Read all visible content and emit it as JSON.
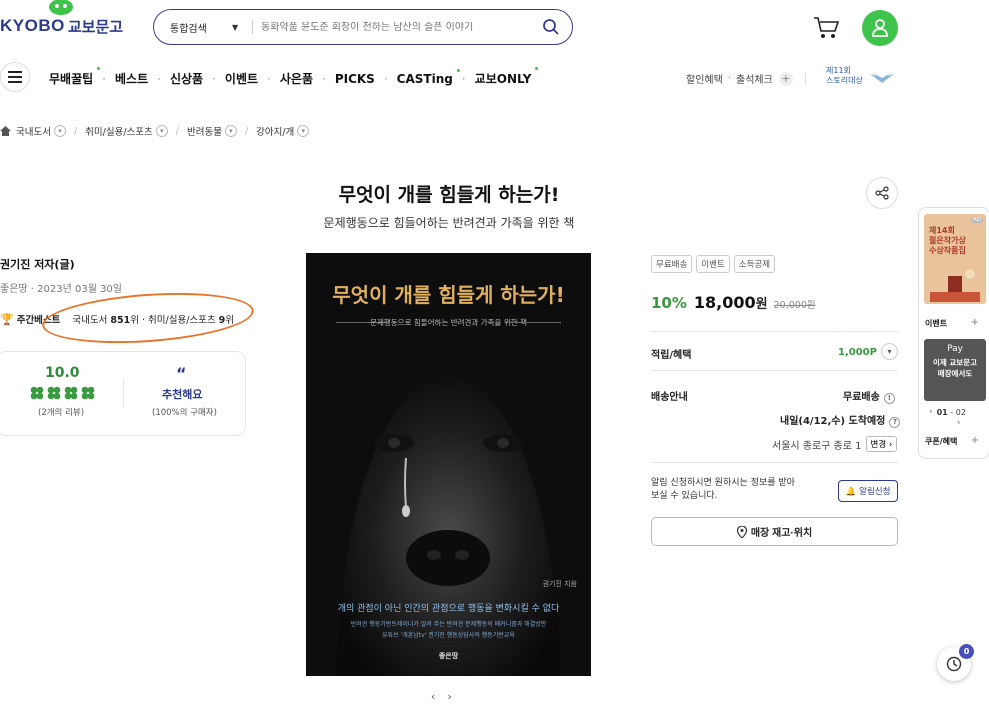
{
  "header": {
    "logo_text": "KYOBO",
    "logo_kr": "교보문고",
    "search_scope": "통합검색",
    "search_placeholder": "동화약품 윤도준 회장이 전하는 남산의 슬픈 이야기",
    "brand_color": "#2b3a8a",
    "accent_color": "#3ec44a"
  },
  "nav": {
    "items": [
      "무배꿀팁",
      "베스트",
      "신상품",
      "이벤트",
      "사은품",
      "PICKS",
      "CASTing",
      "교보ONLY"
    ],
    "discount": "할인혜택",
    "attendance": "출석체크",
    "award": [
      "제11회",
      "스토리대상"
    ]
  },
  "breadcrumb": [
    "국내도서",
    "취미/실용/스포츠",
    "반려동물",
    "강아지/개"
  ],
  "book": {
    "title": "무엇이 개를 힘들게 하는가!",
    "subtitle": "문제행동으로 힘들어하는 반려견과 가족을 위한 책",
    "author": "권기진 저자(글)",
    "publisher_date": "좋은땅 · 2023년 03월 30일",
    "bestseller_label": "주간베스트",
    "rank_domestic": "국내도서 ",
    "rank_domestic_num": "851",
    "rank_mid": "위 · 취미/실용/스포츠 ",
    "rank_hobby_num": "9",
    "rank_end": "위"
  },
  "rating": {
    "score": "10.0",
    "reviews": "(2개의 리뷰)",
    "recommend": "추천해요",
    "recommend_pct": "(100%의 구매자)"
  },
  "cover": {
    "title": "무엇이 개를 힘들게 하는가!",
    "subtitle": "문제행동으로 힘들어하는 반려견과 가족을 위한 책",
    "author": "권기진 지음",
    "tagline": "개의 관점이 아닌 인간의 관점으로 행동을 변화시킬 수 없다",
    "line1": "반려견 행동기반트레이너가 알려 주는 반려견 문제행동의 메커니즘과 해결방안",
    "line2": "유튜브 '개훈남tv' 권기진 행동상담사의 행동기반교육",
    "publisher": "좋은땅"
  },
  "pricing": {
    "tags": [
      "무료배송",
      "이벤트",
      "소득공제"
    ],
    "discount": "10%",
    "sale_price": "18,000",
    "won": "원",
    "original_price": "20,000원",
    "points_label": "적립/혜택",
    "points_value": "1,000P",
    "shipping_label": "배송안내",
    "shipping_free": "무료배송",
    "delivery_date": "내일(4/12,수) 도착예정",
    "address": "서울시 종로구 종로 1",
    "change": "변경",
    "notify_text": "알림 신청하시면 원하시는 정보를 받아 보실 수 있습니다.",
    "notify_btn": "알림신청",
    "store_btn": "매장 재고·위치"
  },
  "side": {
    "ad_badge": "AD",
    "ad_text": [
      "제14회",
      "젊은작가상",
      "수상작품집"
    ],
    "event": "이벤트",
    "pay_logo": "Pay",
    "pay_text": [
      "이제 교보문고",
      "매장에서도"
    ],
    "page": "01",
    "page_total": "02",
    "coupon": "쿠폰/혜택"
  },
  "recent_count": "0"
}
